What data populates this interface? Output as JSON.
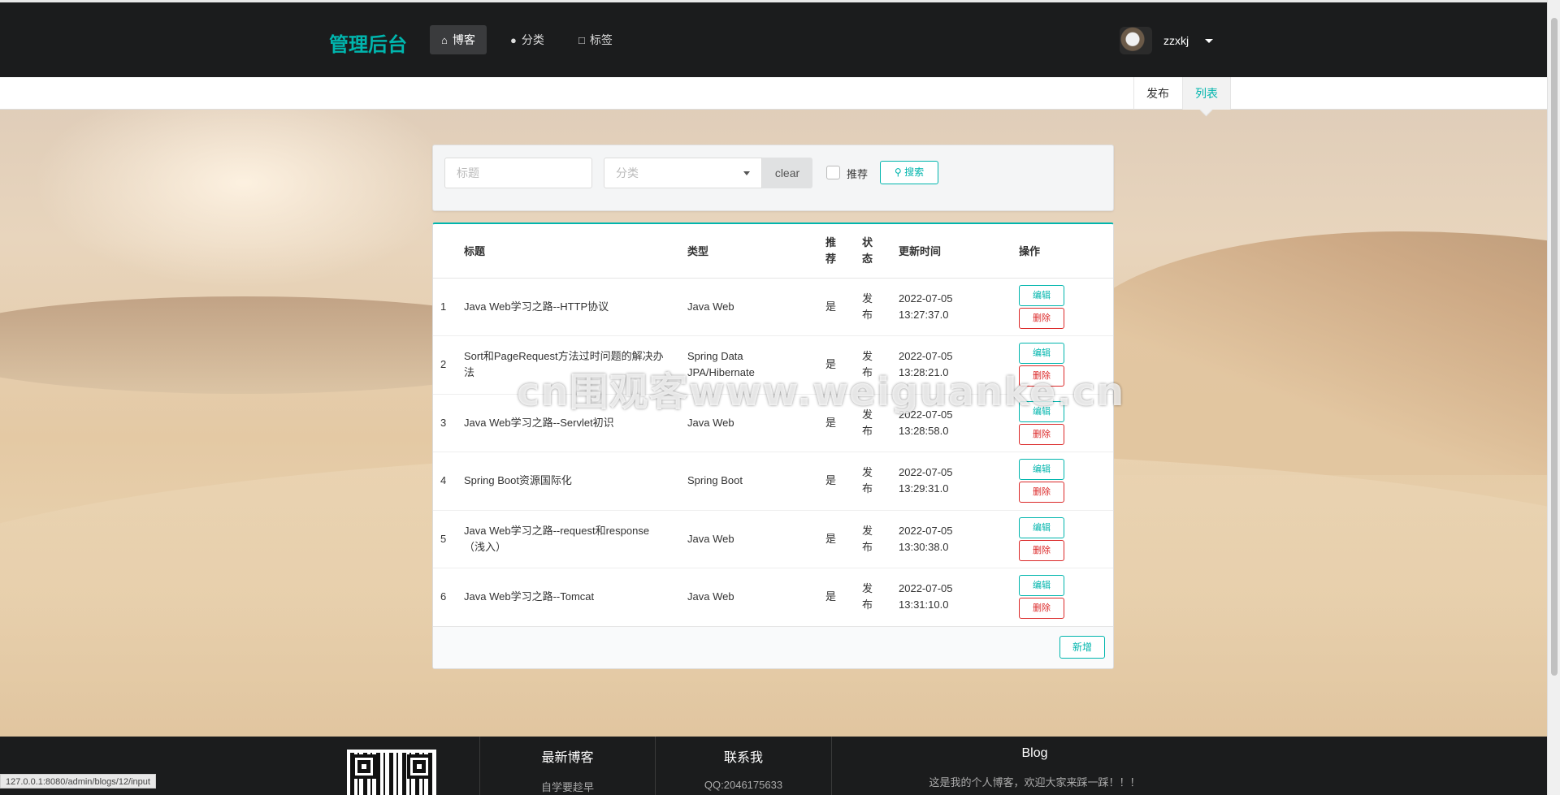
{
  "nav": {
    "brand": "管理后台",
    "items": [
      {
        "label": "博客",
        "icon": "home-icon"
      },
      {
        "label": "分类",
        "icon": "lightbulb-icon"
      },
      {
        "label": "标签",
        "icon": "bookmark-icon"
      }
    ],
    "user": "zzxkj"
  },
  "subnav": {
    "publish": "发布",
    "list": "列表"
  },
  "search": {
    "title_placeholder": "标题",
    "category_placeholder": "分类",
    "clear": "clear",
    "recommend_label": "推荐",
    "search_label": "搜索"
  },
  "table": {
    "headers": {
      "title": "标题",
      "type": "类型",
      "recommend": "推荐",
      "status": "状态",
      "updated": "更新时间",
      "actions": "操作"
    },
    "rows": [
      {
        "idx": "1",
        "title": "Java Web学习之路--HTTP协议",
        "type": "Java Web",
        "rec": "是",
        "status": "发布",
        "date": "2022-07-05",
        "time": "13:27:37.0"
      },
      {
        "idx": "2",
        "title": "Sort和PageRequest方法过时问题的解决办法",
        "type": "Spring Data JPA/Hibernate",
        "rec": "是",
        "status": "发布",
        "date": "2022-07-05",
        "time": "13:28:21.0"
      },
      {
        "idx": "3",
        "title": "Java Web学习之路--Servlet初识",
        "type": "Java Web",
        "rec": "是",
        "status": "发布",
        "date": "2022-07-05",
        "time": "13:28:58.0"
      },
      {
        "idx": "4",
        "title": "Spring Boot资源国际化",
        "type": "Spring Boot",
        "rec": "是",
        "status": "发布",
        "date": "2022-07-05",
        "time": "13:29:31.0"
      },
      {
        "idx": "5",
        "title": "Java Web学习之路--request和response（浅入）",
        "type": "Java Web",
        "rec": "是",
        "status": "发布",
        "date": "2022-07-05",
        "time": "13:30:38.0"
      },
      {
        "idx": "6",
        "title": "Java Web学习之路--Tomcat",
        "type": "Java Web",
        "rec": "是",
        "status": "发布",
        "date": "2022-07-05",
        "time": "13:31:10.0"
      }
    ],
    "edit": "编辑",
    "delete": "删除",
    "add": "新增"
  },
  "watermark": "cn围观客www.weiguanke.cn",
  "footer": {
    "latest_title": "最新博客",
    "latest_item": "自学要趁早",
    "contact_title": "联系我",
    "contact_qq": "QQ:2046175633",
    "blog_title": "Blog",
    "blog_text": "这是我的个人博客，欢迎大家来踩一踩！！！"
  },
  "status_url": "127.0.0.1:8080/admin/blogs/12/input",
  "colors": {
    "accent": "#00b5ad",
    "danger": "#db2828",
    "nav_bg": "#1b1c1d"
  }
}
